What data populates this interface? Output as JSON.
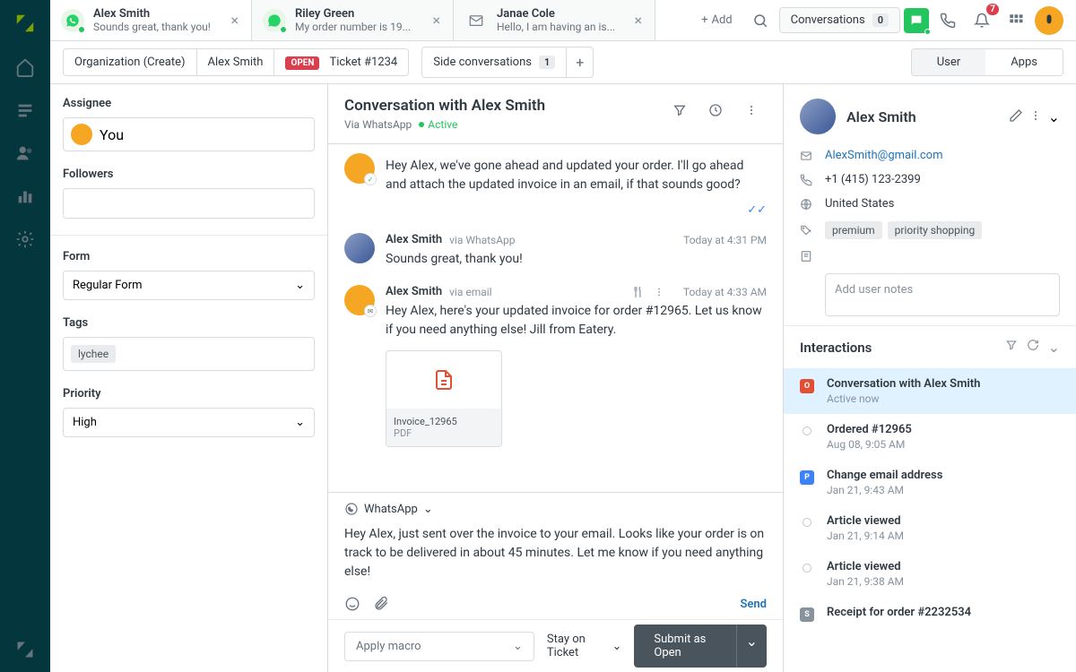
{
  "topbar": {
    "tabs": [
      {
        "title": "Alex Smith",
        "sub": "Sounds great, thank you!",
        "channel": "whatsapp"
      },
      {
        "title": "Riley Green",
        "sub": "My order number is 19...",
        "channel": "whatsapp"
      },
      {
        "title": "Janae Cole",
        "sub": "Hello, I am having an is...",
        "channel": "email"
      }
    ],
    "add_label": "Add",
    "conversations_label": "Conversations",
    "conversations_count": "0",
    "notifications_count": "7"
  },
  "breadcrumb": {
    "org": "Organization (Create)",
    "user": "Alex Smith",
    "open_badge": "OPEN",
    "ticket": "Ticket #1234",
    "side_label": "Side conversations",
    "side_count": "1",
    "user_tab": "User",
    "apps_tab": "Apps"
  },
  "left": {
    "assignee_label": "Assignee",
    "assignee_value": "You",
    "followers_label": "Followers",
    "form_label": "Form",
    "form_value": "Regular Form",
    "tags_label": "Tags",
    "tags": [
      "lychee"
    ],
    "priority_label": "Priority",
    "priority_value": "High"
  },
  "conversation": {
    "title": "Conversation with Alex Smith",
    "via": "Via WhatsApp",
    "status": "Active",
    "messages": [
      {
        "author": "",
        "channel": "",
        "time": "",
        "text": "Hey Alex, we've gone ahead and updated your order. I'll go ahead and attach the updated invoice in an email, if that sounds good?",
        "agent": true,
        "checks": true
      },
      {
        "author": "Alex Smith",
        "channel": "via WhatsApp",
        "time": "Today at 4:31 PM",
        "text": "Sounds great, thank you!"
      },
      {
        "author": "Alex Smith",
        "channel": "via email",
        "time": "Today at 4:33 AM",
        "text": "Hey Alex, here's your updated invoice for order #12965. Let us know if you need anything else! Jill from Eatery.",
        "agent": true,
        "attachment": {
          "name": "Invoice_12965",
          "format": "PDF"
        }
      }
    ],
    "composer": {
      "channel": "WhatsApp",
      "text": "Hey Alex, just sent over the invoice to your email. Looks like your order is on track to be delivered in about 45 minutes. Let me know if you need anything else!",
      "send": "Send"
    },
    "footer": {
      "macro": "Apply macro",
      "stay": "Stay on Ticket",
      "submit": "Submit as Open"
    }
  },
  "user": {
    "name": "Alex Smith",
    "email": "AlexSmith@gmail.com",
    "phone": "+1 (415) 123-2399",
    "location": "United States",
    "tags": [
      "premium",
      "priority shopping"
    ],
    "notes_placeholder": "Add user notes"
  },
  "interactions": {
    "title": "Interactions",
    "items": [
      {
        "badge": "O",
        "color": "#e34f32",
        "title": "Conversation with Alex Smith",
        "sub": "Active now",
        "active": true
      },
      {
        "dot": true,
        "title": "Ordered #12965",
        "sub": "Aug 08, 9:05 AM"
      },
      {
        "badge": "P",
        "color": "#3b82f6",
        "title": "Change email address",
        "sub": "Jan 21, 9:43 AM"
      },
      {
        "dot": true,
        "title": "Article viewed",
        "sub": "Jan 21, 9:14 AM"
      },
      {
        "dot": true,
        "title": "Article viewed",
        "sub": "Jan 21, 9:38 AM"
      },
      {
        "badge": "S",
        "color": "#87929d",
        "title": "Receipt for order #2232534",
        "sub": ""
      }
    ]
  }
}
